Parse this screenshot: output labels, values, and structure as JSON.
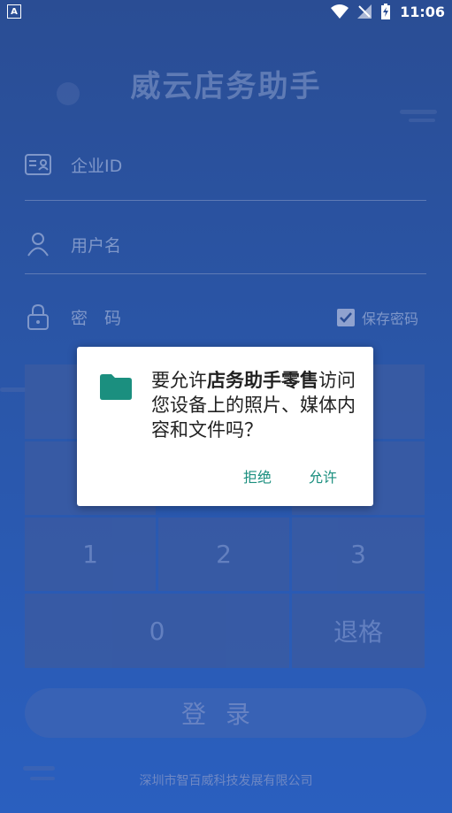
{
  "status_bar": {
    "notification_label": "A",
    "time": "11:06"
  },
  "app": {
    "title": "威云店务助手"
  },
  "form": {
    "company_id_placeholder": "企业ID",
    "username_placeholder": "用户名",
    "password_placeholder": "密　码",
    "save_password_label": "保存密码",
    "save_password_checked": true
  },
  "keypad": {
    "keys": [
      "1",
      "2",
      "3",
      "0",
      "退格"
    ]
  },
  "login": {
    "label": "登录"
  },
  "footer": {
    "company": "深圳市智百威科技发展有限公司"
  },
  "permission_dialog": {
    "prefix": "要允许",
    "app_name": "店务助手零售",
    "suffix": "访问您设备上的照片、媒体内容和文件吗？",
    "deny_label": "拒绝",
    "allow_label": "允许",
    "icon": "folder-icon",
    "accent_color": "#1b8f7f"
  }
}
